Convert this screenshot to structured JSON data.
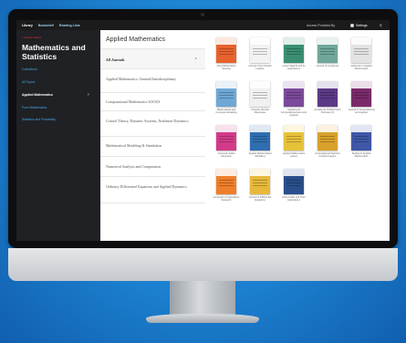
{
  "topnav": {
    "items": [
      "Library",
      "Bookshelf",
      "Reading Lists"
    ],
    "access": "Access Provided By",
    "settings": "Settings"
  },
  "sidebar": {
    "back": "< Always Select",
    "title": "Mathematics and Statistics",
    "items": [
      {
        "label": "Collections"
      },
      {
        "label": "All Topics"
      },
      {
        "label": "Applied Mathematics",
        "active": true
      },
      {
        "label": "Pure Mathematics"
      },
      {
        "label": "Statistics and Probability"
      }
    ]
  },
  "topics": {
    "heading": "Applied Mathematics",
    "items": [
      {
        "label": "All Journals",
        "active": true
      },
      {
        "label": "Applied Mathematics: General/Interdisciplinary"
      },
      {
        "label": "Computational Mathematics SOCKS"
      },
      {
        "label": "Control Theory, Dynamic Systems, Nonlinear Dynamics"
      },
      {
        "label": "Mathematical Modeling & Simulation"
      },
      {
        "label": "Numerical Analysis and Computation"
      },
      {
        "label": "Ordinary Differential Equations and Applied Dynamics"
      }
    ]
  },
  "journals": [
    {
      "title": "Acta Mathematica Scientia",
      "color": "#e8622d"
    },
    {
      "title": "Journal of the Franklin Institute",
      "color": "#f2f2f2"
    },
    {
      "title": "Linear Algebra and its Applications",
      "color": "#3a8f73"
    },
    {
      "title": "Journal of Complexity",
      "color": "#6fa79b"
    },
    {
      "title": "Advances in Applied Mathematics",
      "color": "#e3e3e3"
    },
    {
      "title": "Mathematical and Computer Modelling",
      "color": "#6ea8d6"
    },
    {
      "title": "Comptes Rendus Mecanique",
      "color": "#f0f0f0"
    },
    {
      "title": "Applied and Computational Harmonic Analysis",
      "color": "#7b4a9a"
    },
    {
      "title": "Annales de l'Institut Henri Poincare (C)",
      "color": "#5b3a86"
    },
    {
      "title": "Journal of Computational and Applied",
      "color": "#7a2a6a"
    },
    {
      "title": "Computer Aided Geometric",
      "color": "#d33b8a"
    },
    {
      "title": "Applied Mathematical Modelling",
      "color": "#2f6eb0"
    },
    {
      "title": "Applied Mathematics Letters",
      "color": "#e6c23a"
    },
    {
      "title": "Computational Statistics & Data Analysis",
      "color": "#d9a12b"
    },
    {
      "title": "Studies in Applied Mathematics",
      "color": "#3f57a6"
    },
    {
      "title": "Computers & Operations Research",
      "color": "#ef7f2a"
    },
    {
      "title": "Journal of Differential Equations",
      "color": "#e7b83a"
    },
    {
      "title": "Finite Fields and Their Applications",
      "color": "#2a4f8c"
    }
  ]
}
